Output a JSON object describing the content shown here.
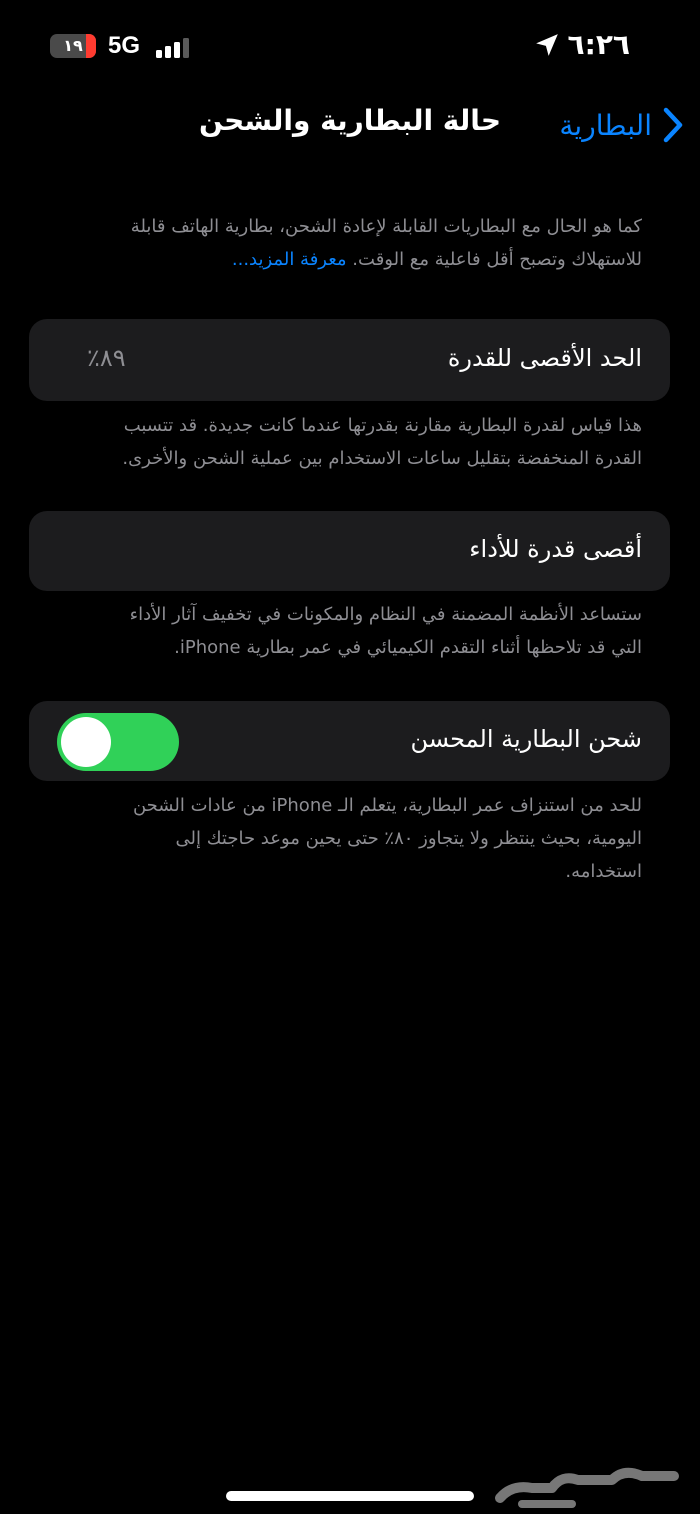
{
  "status_bar": {
    "time": "٦:٢٦",
    "network": "5G",
    "battery_level": "١٩",
    "icons": [
      "location-arrow-icon",
      "signal-bars-icon",
      "battery-icon"
    ]
  },
  "nav": {
    "back_label": "البطارية",
    "title": "حالة البطارية والشحن"
  },
  "intro": {
    "line1": "كما هو الحال مع البطاريات القابلة لإعادة الشحن، بطارية الهاتف قابلة",
    "line2": "للاستهلاك وتصبح أقل فاعلية مع الوقت.",
    "learn_more": "معرفة المزيد..."
  },
  "max_capacity": {
    "label": "الحد الأقصى للقدرة",
    "value": "٨٩٪",
    "footnote_line1": "هذا قياس لقدرة البطارية مقارنة بقدرتها عندما كانت جديدة. قد تتسبب",
    "footnote_line2": "القدرة المنخفضة بتقليل ساعات الاستخدام بين عملية الشحن والأخرى."
  },
  "peak_performance": {
    "label": "أقصى قدرة للأداء",
    "footnote_line1": "ستساعد الأنظمة المضمنة في النظام والمكونات في تخفيف آثار الأداء",
    "footnote_line2": "التي قد تلاحظها أثناء التقدم الكيميائي في عمر بطارية iPhone."
  },
  "optimized_charging": {
    "label": "شحن البطارية المحسن",
    "enabled": true,
    "footnote_line1": "للحد من استنزاف عمر البطارية، يتعلم الـ iPhone من عادات الشحن",
    "footnote_line2": "اليومية، بحيث ينتظر ولا يتجاوز ٨٠٪ حتى يحين موعد حاجتك إلى",
    "footnote_line3": "استخدامه."
  },
  "watermark": {
    "text": "حراج"
  },
  "colors": {
    "background": "#000000",
    "card": "#1c1c1e",
    "accent": "#0a84ff",
    "toggle_on": "#30d158",
    "secondary_text": "#8e8e93",
    "battery_low": "#ff3b30"
  }
}
